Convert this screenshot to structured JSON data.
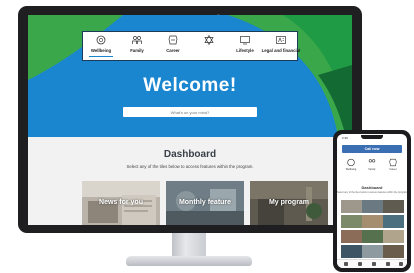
{
  "nav": {
    "items": [
      {
        "label": "Wellbeing",
        "icon": "wellbeing-icon"
      },
      {
        "label": "Family",
        "icon": "family-icon"
      },
      {
        "label": "Career",
        "icon": "career-icon"
      },
      {
        "label": "Lifestyle",
        "icon": "lifestyle-icon"
      },
      {
        "label": "Legal and financial",
        "icon": "legal-financial-icon"
      }
    ]
  },
  "hero": {
    "title": "Welcome!",
    "search_placeholder": "What's on your mind?"
  },
  "dashboard": {
    "title": "Dashboard",
    "subtitle": "Select any of the tiles below to access features within the program.",
    "tiles": [
      {
        "label": "News for you"
      },
      {
        "label": "Monthly feature"
      },
      {
        "label": "My program"
      }
    ]
  },
  "phone": {
    "time": "2:30",
    "call_label": "Call now",
    "dashboard_title": "Dashboard"
  },
  "colors": {
    "hero_blue": "#1a86d0",
    "hero_green": "#3aa84a",
    "call_button": "#3b6fb3"
  }
}
